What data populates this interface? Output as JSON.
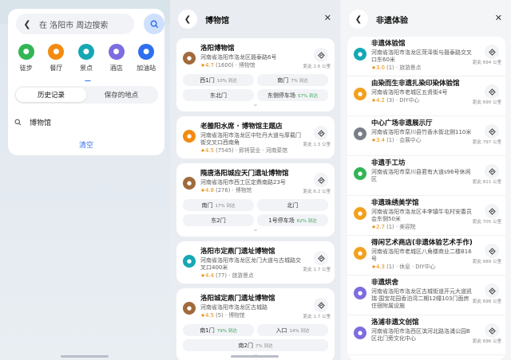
{
  "panel1": {
    "search_placeholder": "在 洛阳市 周边搜索",
    "categories": [
      {
        "label": "徒步",
        "icon": "walk-icon",
        "color": "#33b556"
      },
      {
        "label": "餐厅",
        "icon": "restaurant-icon",
        "color": "#f28b0f"
      },
      {
        "label": "景点",
        "icon": "camera-icon",
        "color": "#16a7b5"
      },
      {
        "label": "酒店",
        "icon": "hotel-icon",
        "color": "#7c6de0"
      },
      {
        "label": "加油站",
        "icon": "gas-station-icon",
        "color": "#2f6ef0"
      }
    ],
    "tabs": [
      {
        "label": "历史记录",
        "active": true
      },
      {
        "label": "保存的地点",
        "active": false
      }
    ],
    "history": [
      {
        "label": "博物馆"
      }
    ],
    "clear_label": "清空"
  },
  "panel2": {
    "title": "博物馆",
    "results": [
      {
        "title": "洛阳博物馆",
        "address": "河南省洛阳市洛龙区聂泰路6号",
        "rating": "★4.7",
        "meta": "(1600) · 博物馆",
        "distance": "距此 2.6 公里",
        "icon_color": "#a16a3c",
        "gates": [
          {
            "label": "西1门",
            "pct": "10% 到达",
            "green": false
          },
          {
            "label": "南门",
            "pct": "7% 到达",
            "green": false
          },
          {
            "label": "东北门",
            "pct": "",
            "green": false
          },
          {
            "label": "东侧停车场",
            "pct": "57% 到达",
            "green": true
          }
        ]
      },
      {
        "title": "老雒阳水席 · 博物馆主题店",
        "address": "河南省洛阳市洛龙区中牡丹大道与厚载门街交叉口西南角",
        "rating": "★4.5",
        "meta": "(7545) · 即将营业 · 河南菜馆",
        "distance": "距此 1.3 公里",
        "icon_color": "#f28b0f",
        "gates": []
      },
      {
        "title": "隋唐洛阳城应天门遗址博物馆",
        "address": "河南省洛阳市西工区定鼎南路23号",
        "rating": "★4.8",
        "meta": "(276) · 博物馆",
        "distance": "距此 6.2 公里",
        "icon_color": "#a16a3c",
        "gates": [
          {
            "label": "南门",
            "pct": "17% 到达",
            "green": false
          },
          {
            "label": "北门",
            "pct": "",
            "green": false
          },
          {
            "label": "东2门",
            "pct": "",
            "green": false
          },
          {
            "label": "1号停车场",
            "pct": "62% 到达",
            "green": true
          }
        ]
      },
      {
        "title": "洛阳市定鼎门遗址博物馆",
        "address": "河南省洛阳市洛龙区龙门大道与古城路交叉口400米",
        "rating": "★4.4",
        "meta": "(77) · 旅游景点",
        "distance": "距此 1.7 公里",
        "icon_color": "#16a7b5",
        "gates": []
      },
      {
        "title": "洛阳城定鼎门遗址博物馆",
        "address": "河南省洛阳市洛龙区古城路",
        "rating": "★4.5",
        "meta": "(5) · 博物馆",
        "distance": "距此 1.7 公里",
        "icon_color": "#a16a3c",
        "gates": [
          {
            "label": "南1门",
            "pct": "79% 到达",
            "green": true
          },
          {
            "label": "入口",
            "pct": "14% 到达",
            "green": false
          },
          {
            "label": "南2门",
            "pct": "7% 到达",
            "green": false,
            "full": true
          }
        ]
      }
    ]
  },
  "panel3": {
    "title": "非遗体验",
    "results": [
      {
        "title": "非遗体验馆",
        "address": "河南省洛阳市洛龙区菏泽街与聂泰路交叉口东60米",
        "rating": "★3.0",
        "meta": "(1) · 旅游景点",
        "distance": "距此 694 公里",
        "icon_color": "#16a7b5"
      },
      {
        "title": "由染而生非遗扎染印染体验馆",
        "address": "河南省洛阳市老城区五贤街4号",
        "rating": "★4.2",
        "meta": "(3) · DIY中心",
        "distance": "距此 690 公里",
        "icon_color": "#f2a11f"
      },
      {
        "title": "中心广场非遗展示厅",
        "address": "河南省洛阳市栾川县竹香水街北侧110米",
        "rating": "★3.4",
        "meta": "(1) · 会展中心",
        "distance": "距此 797 公里",
        "icon_color": "#7a7f87"
      },
      {
        "title": "非遗手工坊",
        "address": "河南省洛阳市栾川县君有大道s96号休闲区",
        "rating": "",
        "meta": "",
        "distance": "距此 811 公里",
        "icon_color": "#33b556"
      },
      {
        "title": "非遗珠绣美学馆",
        "address": "河南省洛阳市洛龙区丰李镇牛屯村安委员会东侧50米",
        "rating": "★2.7",
        "meta": "(1) · 美容院",
        "distance": "距此 705 公里",
        "icon_color": "#f2a11f"
      },
      {
        "title": "得闲艺术商店(非遗体验艺术手作)",
        "address": "河南省洛阳市老城区八角楼商业二楼B16号",
        "rating": "★4.3",
        "meta": "(1) · 休息 · DIY中心",
        "distance": "距此 689 公里",
        "icon_color": "#f2a11f"
      },
      {
        "title": "非遗烘舍",
        "address": "河南省洛阳市洛龙区古城街道开元大道凯瑞·国宝花园香泊湾二期12幢103门面房住宿附属设施",
        "rating": "",
        "meta": "",
        "distance": "距此 698 公里",
        "icon_color": "#7c6de0"
      },
      {
        "title": "洛浦非遗文创馆",
        "address": "河南省洛阳市洛西区滨河北路洛浦公园B区北门旁文化中心",
        "rating": "",
        "meta": "",
        "distance": "距此 696 公里",
        "icon_color": "#7c6de0"
      }
    ]
  }
}
